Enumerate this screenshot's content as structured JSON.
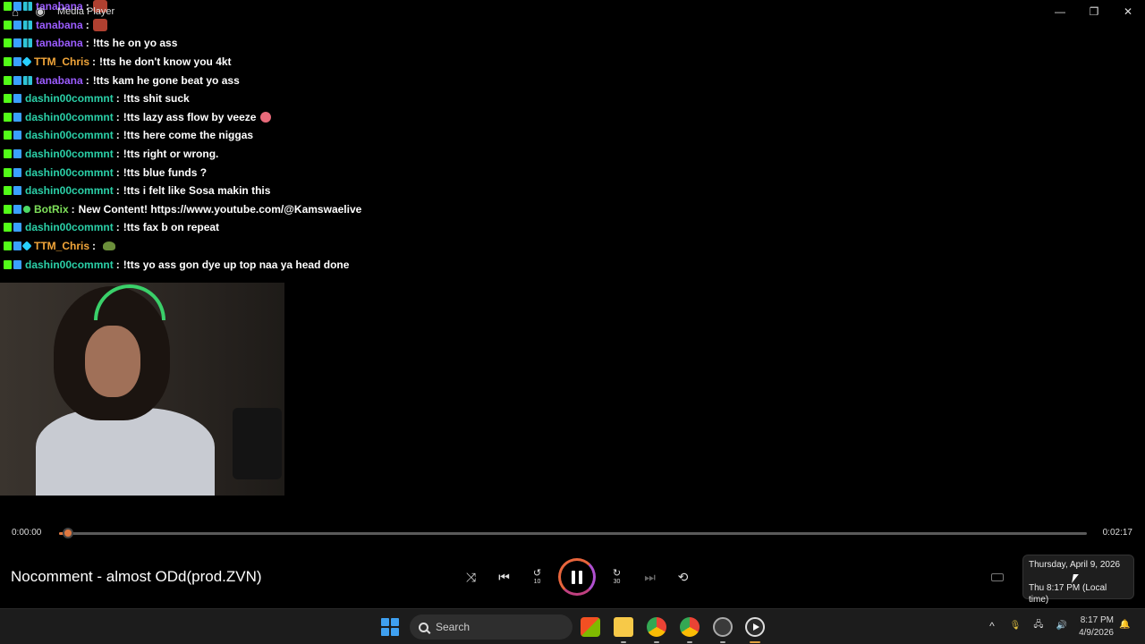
{
  "window": {
    "title": "Media Player",
    "minimize": "—",
    "maximize": "❐",
    "close": "✕"
  },
  "chat": [
    {
      "user": "tanabana",
      "color": "#9b5cff",
      "text": "",
      "emote": true,
      "badges": [
        "green",
        "blue",
        "grid"
      ]
    },
    {
      "user": "tanabana",
      "color": "#9b5cff",
      "text": "",
      "emote": true,
      "badges": [
        "green",
        "blue",
        "grid"
      ]
    },
    {
      "user": "tanabana",
      "color": "#9b5cff",
      "text": "!tts he on yo ass",
      "badges": [
        "green",
        "blue",
        "grid"
      ]
    },
    {
      "user": "TTM_Chris",
      "color": "#f2a63a",
      "text": "!tts he don't know you 4kt",
      "badges": [
        "green",
        "blue",
        "cyan"
      ]
    },
    {
      "user": "tanabana",
      "color": "#9b5cff",
      "text": "!tts kam he gone beat yo ass",
      "badges": [
        "green",
        "blue",
        "grid"
      ]
    },
    {
      "user": "dashin00commnt",
      "color": "#2bd0a8",
      "text": "!tts shit suck",
      "badges": [
        "green",
        "blue"
      ]
    },
    {
      "user": "dashin00commnt",
      "color": "#2bd0a8",
      "text": "!tts lazy ass flow by veeze",
      "emote3": true,
      "badges": [
        "green",
        "blue"
      ]
    },
    {
      "user": "dashin00commnt",
      "color": "#2bd0a8",
      "text": "!tts here come the niggas",
      "badges": [
        "green",
        "blue"
      ]
    },
    {
      "user": "dashin00commnt",
      "color": "#2bd0a8",
      "text": "!tts right or wrong.",
      "badges": [
        "green",
        "blue"
      ]
    },
    {
      "user": "dashin00commnt",
      "color": "#2bd0a8",
      "text": "!tts blue funds ?",
      "badges": [
        "green",
        "blue"
      ]
    },
    {
      "user": "dashin00commnt",
      "color": "#2bd0a8",
      "text": "!tts i felt like Sosa makin this",
      "badges": [
        "green",
        "blue"
      ]
    },
    {
      "user": "BotRix",
      "color": "#7ee05a",
      "text": "New Content! https://www.youtube.com/@Kamswaelive",
      "badges": [
        "green",
        "blue",
        "bot"
      ]
    },
    {
      "user": "dashin00commnt",
      "color": "#2bd0a8",
      "text": "!tts fax b on repeat",
      "badges": [
        "green",
        "blue"
      ]
    },
    {
      "user": "TTM_Chris",
      "color": "#f2a63a",
      "text": "",
      "emote2": true,
      "badges": [
        "green",
        "blue",
        "cyan"
      ]
    },
    {
      "user": "dashin00commnt",
      "color": "#2bd0a8",
      "text": "!tts yo ass gon dye up top naa ya head done",
      "badges": [
        "green",
        "blue"
      ]
    }
  ],
  "player": {
    "elapsed": "0:00:00",
    "duration": "0:02:17",
    "progress": 0.01,
    "song_title": "Nocomment - almost ODd(prod.ZVN)",
    "controls": {
      "shuffle": "⤨",
      "previous": "⏮",
      "rewind": "↺",
      "rewind_label": "10",
      "forward": "↻",
      "forward_label": "30",
      "next": "⏭",
      "repeat": "⟲"
    }
  },
  "tooltip": {
    "date": "Thursday, April 9, 2026",
    "local_time": "Thu 8:17 PM (Local time)"
  },
  "taskbar": {
    "search_placeholder": "Search",
    "clock_time": "8:17 PM",
    "clock_date": "4/9/2026",
    "tray_chevron": "^",
    "tray_mic": "🎙",
    "tray_network": "🖧",
    "tray_volume": "🔊",
    "notification": "🔔"
  },
  "colors": {
    "accent": "#e07840",
    "background": "#000000",
    "taskbar": "#1c1c1c"
  }
}
